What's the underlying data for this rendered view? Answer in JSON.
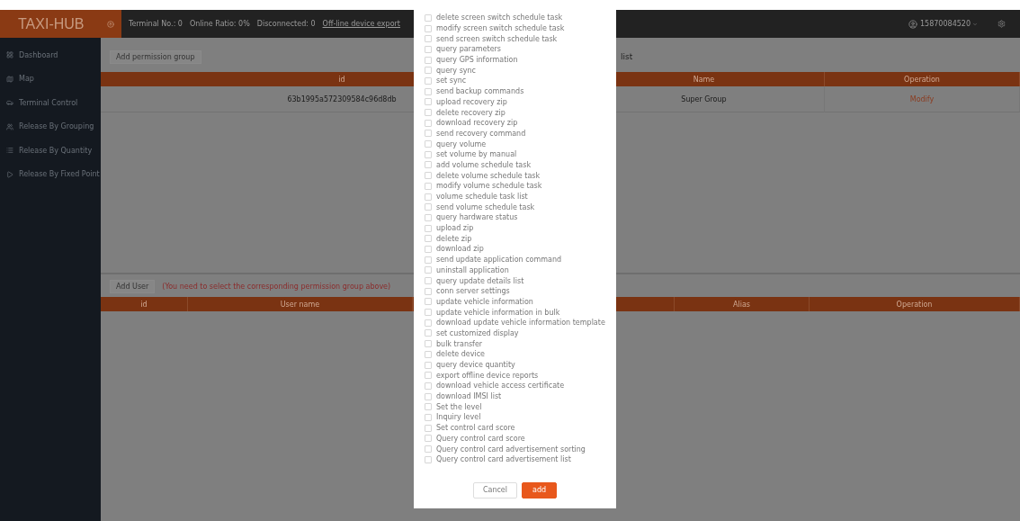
{
  "app": {
    "logo": "TAXI-HUB"
  },
  "top_bar": {
    "stats": [
      "Terminal No.: 0",
      "Online Ratio: 0%",
      "Disconnected: 0"
    ],
    "export_link": "Off-line device export",
    "user": "15870084520"
  },
  "sidebar": {
    "items": [
      {
        "label": "Dashboard"
      },
      {
        "label": "Map"
      },
      {
        "label": "Terminal Control"
      },
      {
        "label": "Release By Grouping"
      },
      {
        "label": "Release By Quantity"
      },
      {
        "label": "Release By Fixed Point"
      }
    ]
  },
  "permission_groups": {
    "add_button": "Add permission group",
    "title": "list",
    "columns": [
      "id",
      "Name",
      "Operation"
    ],
    "rows": [
      {
        "id": "63b1995a572309584c96d8db",
        "name": "Super Group",
        "operation": "Modify"
      }
    ]
  },
  "users": {
    "add_button": "Add User",
    "hint": "(You need to select the corresponding permission group above)",
    "columns": [
      "id",
      "User name",
      "Alias",
      "Operation"
    ]
  },
  "dialog": {
    "permissions": [
      {
        "label": "delete screen switch schedule task",
        "checked": false
      },
      {
        "label": "modify screen switch schedule task",
        "checked": false
      },
      {
        "label": "send screen switch schedule task",
        "checked": false
      },
      {
        "label": "query parameters",
        "checked": false
      },
      {
        "label": "query GPS information",
        "checked": false
      },
      {
        "label": "query sync",
        "checked": false
      },
      {
        "label": "set sync",
        "checked": false
      },
      {
        "label": "send backup commands",
        "checked": false
      },
      {
        "label": "upload recovery zip",
        "checked": false
      },
      {
        "label": "delete recovery zip",
        "checked": false
      },
      {
        "label": "download recovery zip",
        "checked": false
      },
      {
        "label": "send recovery command",
        "checked": false
      },
      {
        "label": "query volume",
        "checked": false
      },
      {
        "label": "set volume by manual",
        "checked": false
      },
      {
        "label": "add volume schedule task",
        "checked": false
      },
      {
        "label": "delete volume schedule task",
        "checked": false
      },
      {
        "label": "modify volume schedule task",
        "checked": false
      },
      {
        "label": "volume schedule task list",
        "checked": false
      },
      {
        "label": "send volume schedule task",
        "checked": false
      },
      {
        "label": "query hardware status",
        "checked": false
      },
      {
        "label": "upload zip",
        "checked": false
      },
      {
        "label": "delete zip",
        "checked": false
      },
      {
        "label": "download zip",
        "checked": false
      },
      {
        "label": "send update application command",
        "checked": false
      },
      {
        "label": "uninstall application",
        "checked": false
      },
      {
        "label": "query update details list",
        "checked": false
      },
      {
        "label": "conn server settings",
        "checked": false
      },
      {
        "label": "update vehicle information",
        "checked": false
      },
      {
        "label": "update vehicle information in bulk",
        "checked": false
      },
      {
        "label": "download update vehicle information template",
        "checked": false
      },
      {
        "label": "set customized display",
        "checked": false
      },
      {
        "label": "bulk transfer",
        "checked": false
      },
      {
        "label": "delete device",
        "checked": false
      },
      {
        "label": "query device quantity",
        "checked": false
      },
      {
        "label": "export offline device reports",
        "checked": false
      },
      {
        "label": "download vehicle access certificate",
        "checked": false
      },
      {
        "label": "download IMSI list",
        "checked": false
      },
      {
        "label": "Set the level",
        "checked": false
      },
      {
        "label": "Inquiry level",
        "checked": false
      },
      {
        "label": "Set control card score",
        "checked": false
      },
      {
        "label": "Query control card score",
        "checked": false
      },
      {
        "label": "Query control card advertisement sorting",
        "checked": false
      },
      {
        "label": "Query control card advertisement list",
        "checked": false
      }
    ],
    "buttons": [
      {
        "label": "Cancel",
        "kind": "secondary"
      },
      {
        "label": "add",
        "kind": "primary"
      }
    ]
  }
}
